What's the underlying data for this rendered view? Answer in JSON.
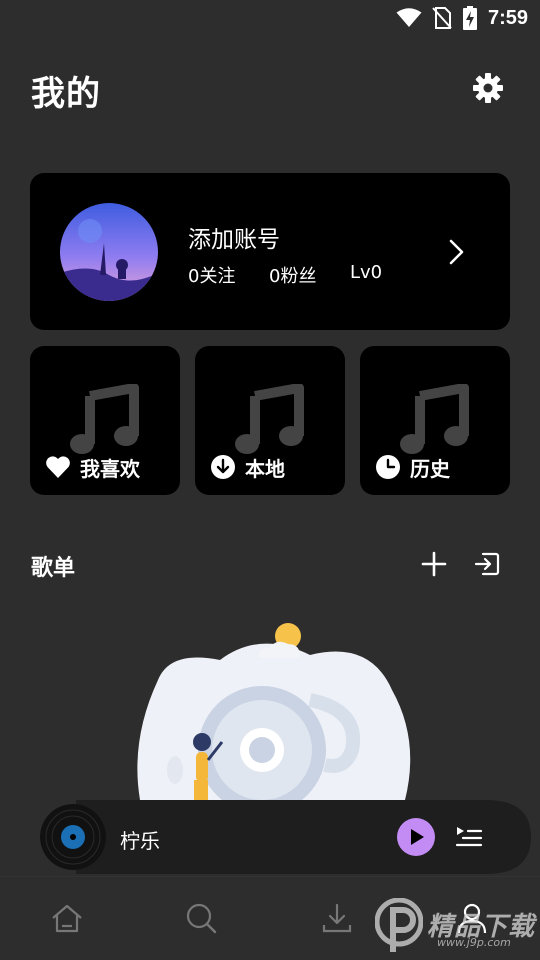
{
  "status_bar": {
    "time": "7:59"
  },
  "header": {
    "title": "我的"
  },
  "account": {
    "name": "添加账号",
    "follow": "0关注",
    "fans": "0粉丝",
    "level": "Lv0"
  },
  "quick_actions": [
    {
      "label": "我喜欢",
      "icon": "heart-icon"
    },
    {
      "label": "本地",
      "icon": "download-icon"
    },
    {
      "label": "历史",
      "icon": "clock-icon"
    }
  ],
  "playlist_section": {
    "title": "歌单"
  },
  "player": {
    "song": "柠乐",
    "accent": "#c38cf5"
  },
  "bottom_nav": [
    {
      "name": "home-icon"
    },
    {
      "name": "search-icon"
    },
    {
      "name": "download-icon"
    },
    {
      "name": "profile-icon"
    }
  ],
  "watermark": {
    "text": "精品下载",
    "sub": "www.j9p.com"
  }
}
